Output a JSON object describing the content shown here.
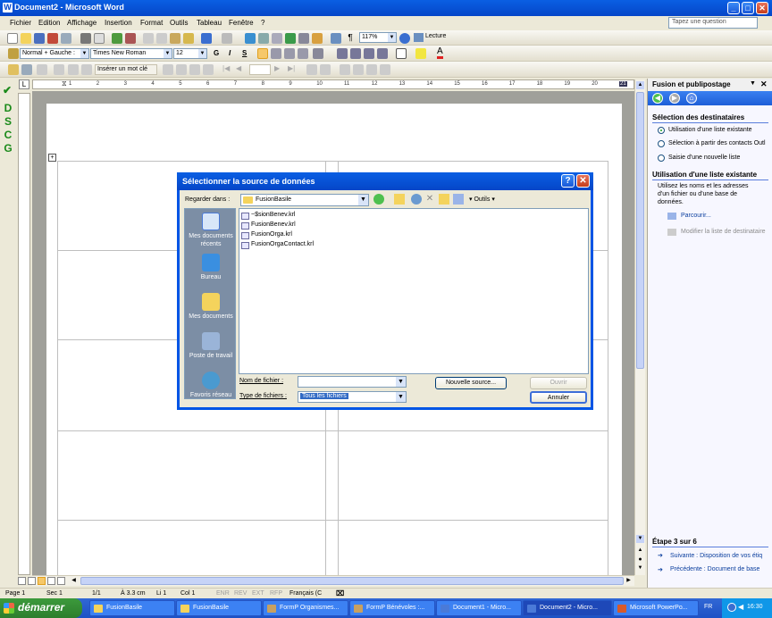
{
  "window": {
    "title": "Document2 - Microsoft Word"
  },
  "menu": [
    "Fichier",
    "Edition",
    "Affichage",
    "Insertion",
    "Format",
    "Outils",
    "Tableau",
    "Fenêtre",
    "?"
  ],
  "ask_placeholder": "Tapez une question",
  "toolbar": {
    "zoom": "117%",
    "reading": "Lecture",
    "style": "Normal + Gauche :",
    "font": "Times New Roman",
    "size": "12",
    "bold": "G",
    "italic": "I",
    "underline": "S",
    "insert_field": "Insérer un mot clé"
  },
  "left_toolbar": [
    "D",
    "S",
    "C",
    "G"
  ],
  "ruler_numbers": [
    "1",
    "2",
    "3",
    "4",
    "5",
    "6",
    "7",
    "8",
    "9",
    "10",
    "11",
    "12",
    "13",
    "14",
    "15",
    "16",
    "17",
    "18",
    "19",
    "20",
    "21"
  ],
  "taskpane": {
    "title": "Fusion et publipostage",
    "section1": "Sélection des destinataires",
    "options": [
      "Utilisation d'une liste existante",
      "Sélection à partir des contacts Outl",
      "Saisie d'une nouvelle liste"
    ],
    "selected_option": 0,
    "section2": "Utilisation d'une liste existante",
    "desc": [
      "Utilisez les noms et les adresses",
      "d'un fichier ou d'une base de",
      "données."
    ],
    "browse": "Parcourir...",
    "edit_list": "Modifier la liste de destinataire",
    "step": "Étape 3 sur 6",
    "next": "Suivante : Disposition de vos étiq",
    "prev": "Précédente : Document de base"
  },
  "dialog": {
    "title": "Sélectionner la source de données",
    "look_in_label": "Regarder dans :",
    "look_in": "FusionBasile",
    "tools_label": "Outils",
    "places": [
      "Mes documents récents",
      "Bureau",
      "Mes documents",
      "Poste de travail",
      "Favoris réseau"
    ],
    "files": [
      "~$sionBenev.krl",
      "FusionBenev.krl",
      "FusionOrga.krl",
      "FusionOrgaContact.krl"
    ],
    "filename_label": "Nom de fichier :",
    "filename_value": "",
    "filetype_label": "Type de fichiers :",
    "filetype_value": "Tous les fichiers",
    "new_source": "Nouvelle source...",
    "open": "Ouvrir",
    "cancel": "Annuler"
  },
  "status": {
    "page": "Page 1",
    "section": "Sec 1",
    "pages": "1/1",
    "at": "À 3.3 cm",
    "line": "Li 1",
    "col": "Col 1",
    "rec": "ENR",
    "rev": "REV",
    "ext": "EXT",
    "ovr": "RFP",
    "lang": "Français (C"
  },
  "taskbar": {
    "start": "démarrer",
    "buttons": [
      "FusionBasile",
      "FusionBasile",
      "FormP Organismes...",
      "FormP Bénévoles :...",
      "Document1 - Micro...",
      "Document2 - Micro...",
      "Microsoft PowerPo..."
    ],
    "active_index": 5,
    "lang": "FR",
    "clock": "16:30"
  },
  "colors": {
    "title_blue": "#0a5fe3",
    "start_green": "#3c9a3c",
    "dscg_green": "#1a8a1a",
    "link_blue": "#0a3e9e"
  }
}
